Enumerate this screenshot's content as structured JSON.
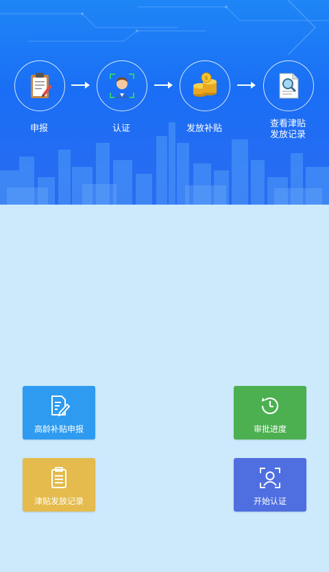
{
  "banner": {
    "steps": [
      {
        "label": "申报",
        "icon": "clipboard-icon"
      },
      {
        "label": "认证",
        "icon": "face-scan-person-icon"
      },
      {
        "label": "发放补贴",
        "icon": "gold-coins-icon"
      },
      {
        "label_line1": "查看津贴",
        "label_line2": "发放记录",
        "icon": "document-search-icon"
      }
    ]
  },
  "menu": {
    "apply": {
      "label": "高龄补贴申报",
      "color": "#2e9bf0",
      "icon": "edit-document-icon"
    },
    "progress": {
      "label": "审批进度",
      "color": "#4caf50",
      "icon": "clock-history-icon"
    },
    "records": {
      "label": "津贴发放记录",
      "color": "#e4bb4c",
      "icon": "clipboard-list-icon"
    },
    "verify": {
      "label": "开始认证",
      "color": "#4f6fe0",
      "icon": "face-scan-icon"
    }
  }
}
